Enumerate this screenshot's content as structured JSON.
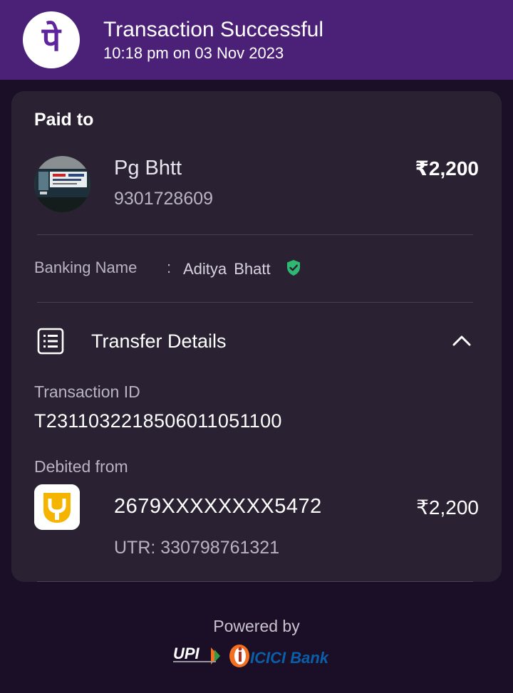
{
  "header": {
    "logo_glyph": "पे",
    "title": "Transaction Successful",
    "timestamp": "10:18 pm on 03 Nov 2023"
  },
  "payment": {
    "section_label": "Paid to",
    "payee_name": "Pg Bhtt",
    "payee_phone": "9301728609",
    "amount": "₹2,200"
  },
  "banking": {
    "label": "Banking Name",
    "separator": ":",
    "value": "Aditya  Bhatt"
  },
  "transfer": {
    "title": "Transfer Details",
    "transaction_id_label": "Transaction ID",
    "transaction_id": "T2311032218506011051100",
    "debited_label": "Debited from",
    "account_number": "2679XXXXXXXX5472",
    "amount": "₹2,200",
    "utr": "UTR: 330798761321"
  },
  "footer": {
    "powered_by": "Powered by",
    "upi_logo_text": "UPI",
    "bank_logo_text": "ICICI Bank"
  },
  "colors": {
    "header_bg": "#4b2178",
    "page_bg": "#1a0f26",
    "card_bg": "#2a2233",
    "verified_green": "#2eb872",
    "pnb_yellow": "#f4b400",
    "icici_orange": "#f37021",
    "icici_blue": "#0b5ea8"
  }
}
